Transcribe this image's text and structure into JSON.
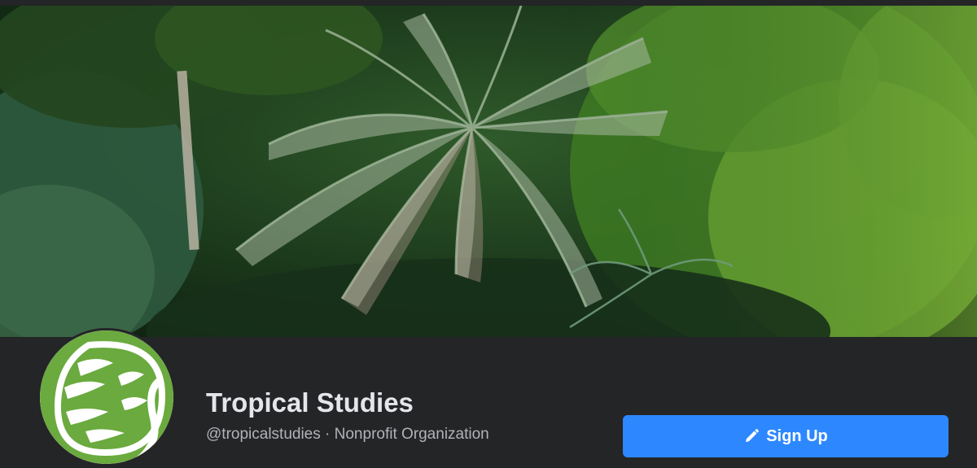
{
  "page": {
    "name": "Tropical Studies",
    "handle": "@tropicalstudies",
    "separator": "·",
    "category": "Nonprofit Organization",
    "meta_line": "@tropicalstudies · Nonprofit Organization"
  },
  "actions": {
    "signup_label": "Sign Up",
    "signup_icon": "pencil-icon"
  },
  "colors": {
    "background": "#242526",
    "primary_button": "#2d88ff",
    "name_text": "#e4e6eb",
    "meta_text": "#b0b3b8",
    "logo_green": "#6aaa3e"
  }
}
